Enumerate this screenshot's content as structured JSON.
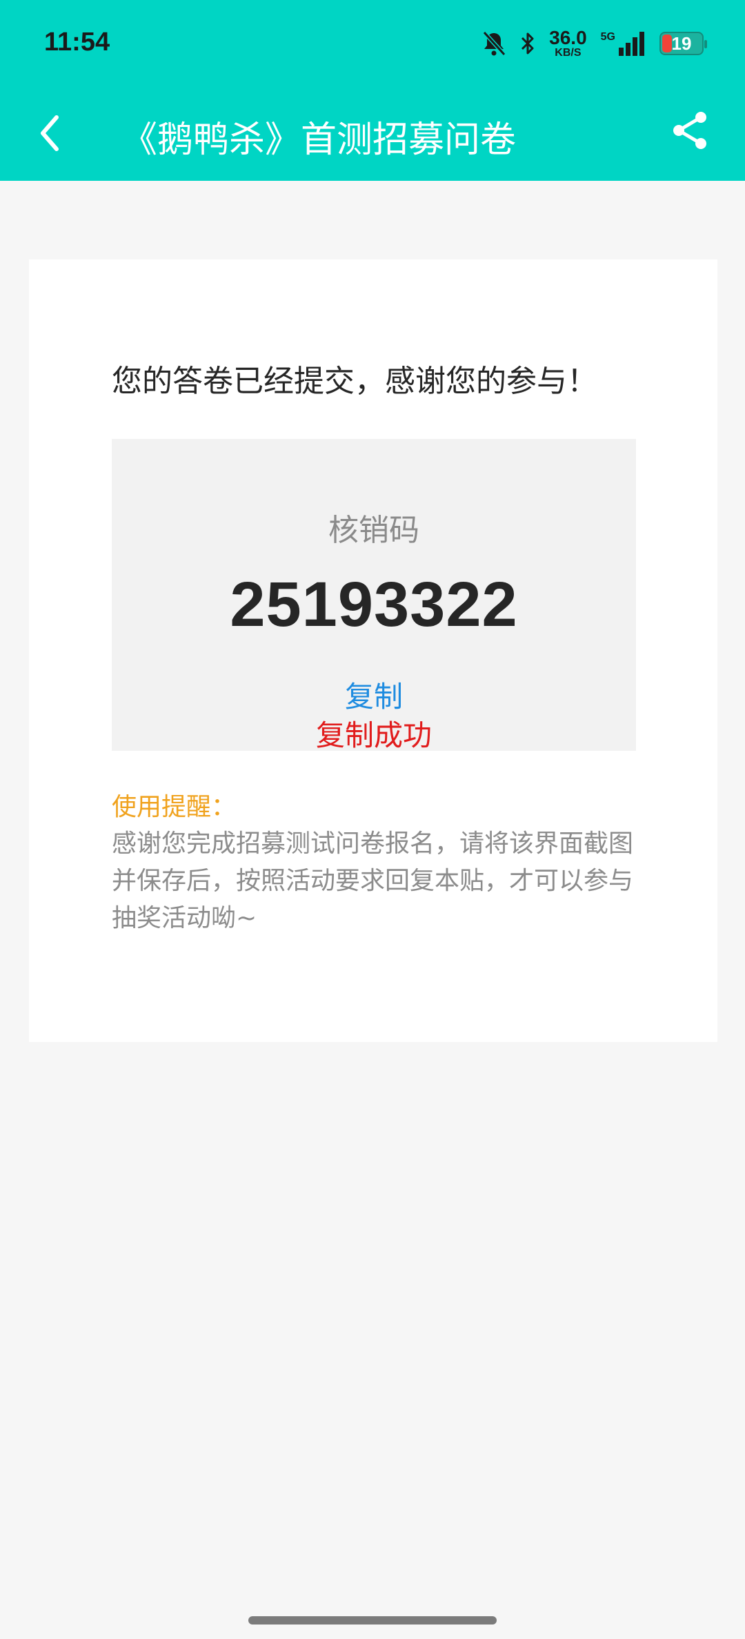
{
  "status_bar": {
    "time": "11:54",
    "net_speed": "36.0",
    "net_speed_unit": "KB/S",
    "network": "5G",
    "battery": "19",
    "icons": [
      "bell-off-icon",
      "bluetooth-icon",
      "signal-icon",
      "battery-icon"
    ]
  },
  "header": {
    "title": "《鹅鸭杀》首测招募问卷",
    "accent_color": "#00d5c4"
  },
  "card": {
    "submitted_text": "您的答卷已经提交，感谢您的参与！",
    "code_label": "核销码",
    "code_value": "25193322",
    "copy_label": "复制",
    "copy_success": "复制成功",
    "reminder_title": "使用提醒：",
    "reminder_text": "感谢您完成招募测试问卷报名，请将该界面截图并保存后，按照活动要求回复本贴，才可以参与抽奖活动呦~"
  }
}
